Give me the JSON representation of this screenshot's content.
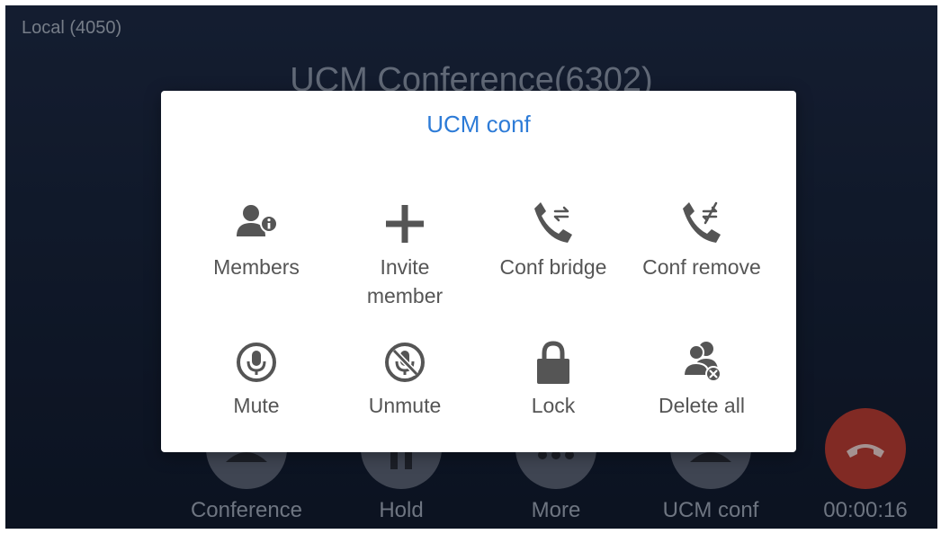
{
  "screen": {
    "account_label": "Local (4050)",
    "call_title": "UCM Conference(6302)",
    "call_timer": "00:00:16"
  },
  "call_actions": [
    {
      "label": "Conference",
      "icon": "conference-icon"
    },
    {
      "label": "Hold",
      "icon": "hold-icon"
    },
    {
      "label": "More",
      "icon": "more-icon"
    },
    {
      "label": "UCM conf",
      "icon": "ucm-conf-icon"
    },
    {
      "icon": "hangup-icon",
      "color": "#bf3e35"
    }
  ],
  "dialog": {
    "title": "UCM conf",
    "items": [
      {
        "label": "Members",
        "icon": "member-info-icon"
      },
      {
        "label": "Invite\nmember",
        "icon": "plus-icon"
      },
      {
        "label": "Conf bridge",
        "icon": "phone-transfer-icon"
      },
      {
        "label": "Conf remove",
        "icon": "phone-no-transfer-icon"
      },
      {
        "label": "Mute",
        "icon": "microphone-icon"
      },
      {
        "label": "Unmute",
        "icon": "microphone-off-icon"
      },
      {
        "label": "Lock",
        "icon": "lock-icon"
      },
      {
        "label": "Delete all",
        "icon": "group-remove-icon"
      }
    ]
  },
  "colors": {
    "accent": "#2d7bd7",
    "icon": "#555555",
    "hangup": "#bf3e35"
  }
}
